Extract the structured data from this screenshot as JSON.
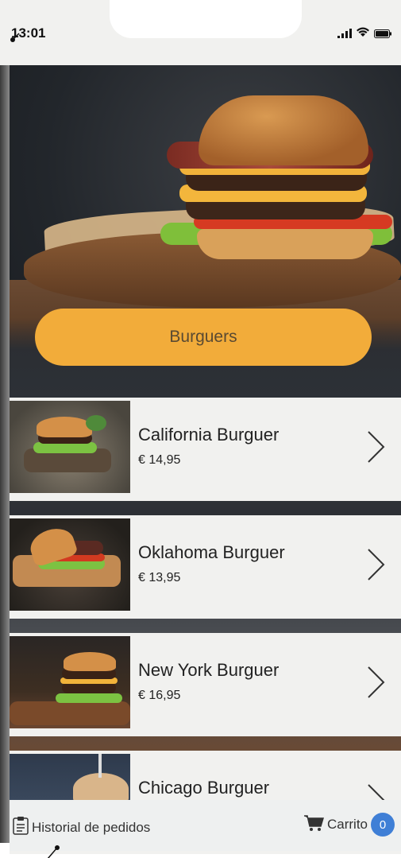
{
  "status": {
    "time": "13:01"
  },
  "hero": {
    "category_label": "Burguers"
  },
  "products": [
    {
      "name": "California Burguer",
      "price": "€ 14,95"
    },
    {
      "name": "Oklahoma Burguer",
      "price": "€ 13,95"
    },
    {
      "name": "New York Burguer",
      "price": "€ 16,95"
    },
    {
      "name": "Chicago Burguer",
      "price": ""
    }
  ],
  "bottom_nav": {
    "history_label": "Historial de pedidos",
    "cart_label": "Carrito",
    "cart_count": "0"
  },
  "colors": {
    "accent": "#f2ac3a",
    "badge": "#3f7fd6"
  },
  "icons": [
    "signal-icon",
    "wifi-icon",
    "battery-icon",
    "chevron-right-icon",
    "clipboard-icon",
    "cart-icon"
  ]
}
